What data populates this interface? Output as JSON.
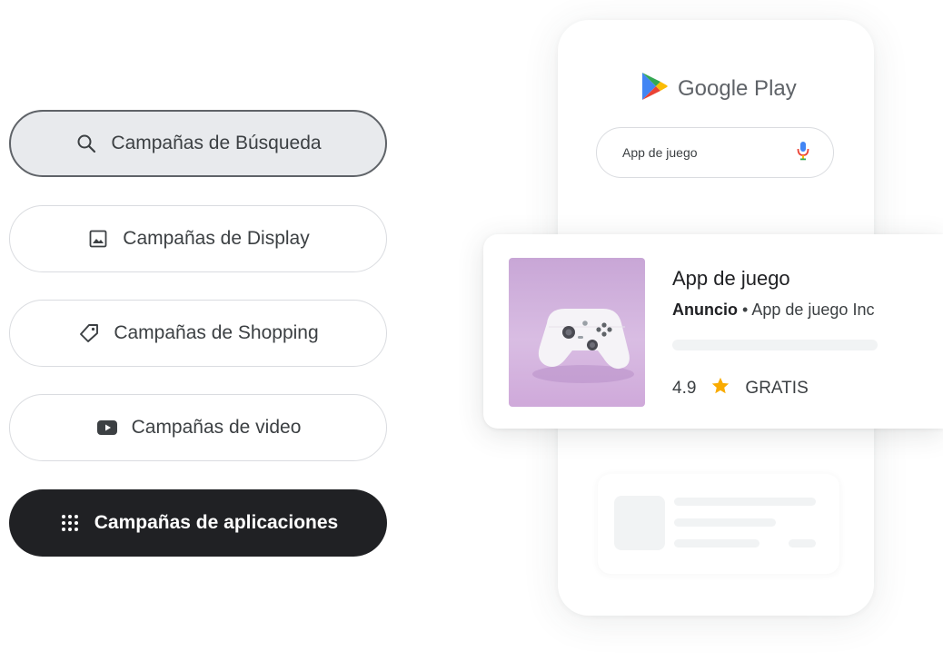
{
  "campaigns": [
    {
      "label": "Campañas de Búsqueda",
      "icon": "search-icon",
      "state": "selected"
    },
    {
      "label": "Campañas de Display",
      "icon": "image-icon",
      "state": "default"
    },
    {
      "label": "Campañas de Shopping",
      "icon": "tag-icon",
      "state": "default"
    },
    {
      "label": "Campañas de video",
      "icon": "video-play-icon",
      "state": "default"
    },
    {
      "label": "Campañas de aplicaciones",
      "icon": "apps-grid-icon",
      "state": "active"
    }
  ],
  "phone": {
    "brand": "Google Play",
    "search": {
      "value": "App de juego",
      "icon": "microphone-icon"
    }
  },
  "ad": {
    "title": "App de juego",
    "ad_label": "Anuncio",
    "separator": "•",
    "publisher": "App de juego Inc",
    "rating": "4.9",
    "price": "GRATIS",
    "rating_icon": "star-icon",
    "image": "game-controller"
  },
  "colors": {
    "dark_pill": "#202124",
    "selected_pill": "#e8eaed",
    "star": "#f9ab00",
    "thumb_purple": "#d3b2df"
  }
}
